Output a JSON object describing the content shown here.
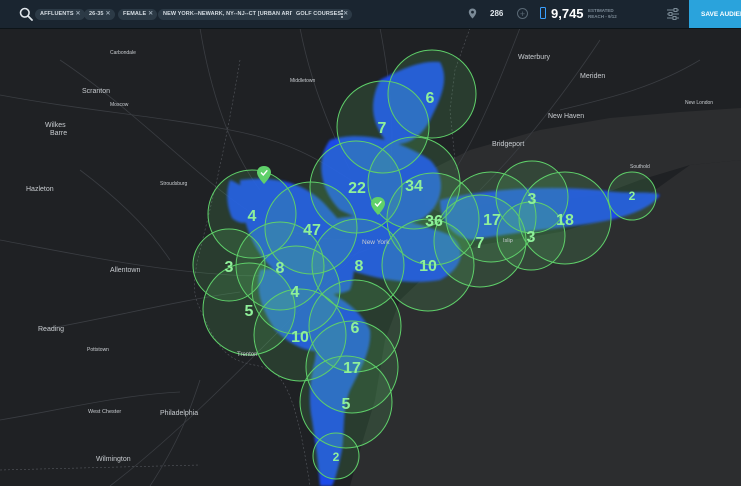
{
  "filters": [
    {
      "label": "AFFLUENTS"
    },
    {
      "label": "26-35"
    },
    {
      "label": "FEMALE"
    },
    {
      "label": "NEW YORK--NEWARK, NY--NJ--CT [URBAN AREA]"
    },
    {
      "label": "GOLF COURSES"
    }
  ],
  "location_count": "286",
  "reach": {
    "value": "9,745",
    "label": "ESTIMATED REACH - 9/12"
  },
  "save_button": "SAVE AUDIEN",
  "map_labels": {
    "waterbury": "Waterbury",
    "meriden": "Meriden",
    "new_london": "New London",
    "new_haven": "New Haven",
    "bridgeport": "Bridgeport",
    "southold": "Southold",
    "scranton": "Scranton",
    "wilkes_barre": "Wilkes\nBarre",
    "hazleton": "Hazleton",
    "allentown": "Allentown",
    "reading": "Reading",
    "philadelphia": "Philadelphia",
    "west_chester": "West Chester",
    "wilmington": "Wilmington",
    "trenton": "Trenton",
    "new_york": "New York",
    "middletown": "Middletown",
    "stroudsburg": "Stroudsburg",
    "pottstown": "Pottstown",
    "islip": "Islip",
    "moscow": "Moscow",
    "carbondale": "Carbondale"
  },
  "clusters": [
    {
      "id": "c6a",
      "value": "6"
    },
    {
      "id": "c7a",
      "value": "7"
    },
    {
      "id": "c22",
      "value": "22"
    },
    {
      "id": "c34",
      "value": "34"
    },
    {
      "id": "c4a",
      "value": "4"
    },
    {
      "id": "c47",
      "value": "47"
    },
    {
      "id": "c36",
      "value": "36"
    },
    {
      "id": "c17a",
      "value": "17"
    },
    {
      "id": "c3a",
      "value": "3"
    },
    {
      "id": "c18",
      "value": "18"
    },
    {
      "id": "c2a",
      "value": "2"
    },
    {
      "id": "c3b",
      "value": "3"
    },
    {
      "id": "c8a",
      "value": "8"
    },
    {
      "id": "c8b",
      "value": "8"
    },
    {
      "id": "c7b",
      "value": "7"
    },
    {
      "id": "c3c",
      "value": "3"
    },
    {
      "id": "c10a",
      "value": "10"
    },
    {
      "id": "c4b",
      "value": "4"
    },
    {
      "id": "c5a",
      "value": "5"
    },
    {
      "id": "c6b",
      "value": "6"
    },
    {
      "id": "c10b",
      "value": "10"
    },
    {
      "id": "c17b",
      "value": "17"
    },
    {
      "id": "c5b",
      "value": "5"
    },
    {
      "id": "c2b",
      "value": "2"
    }
  ],
  "colors": {
    "accent": "#2aa3dc",
    "cluster_fill": "#5fd06a",
    "cluster_text": "#8ff09a",
    "coverage": "#1f4fff"
  }
}
